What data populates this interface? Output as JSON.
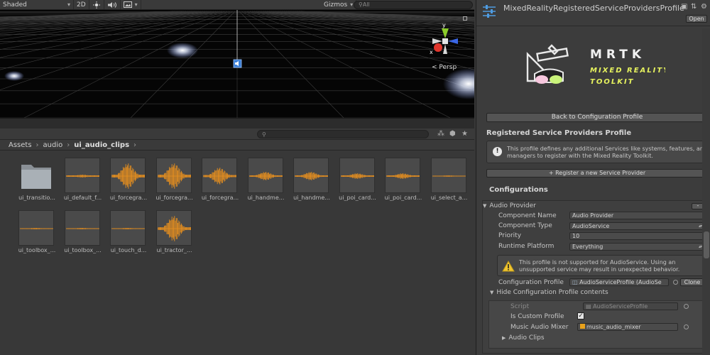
{
  "scene": {
    "shading_mode": "Shaded",
    "mode_2d": "2D",
    "gizmos_label": "Gizmos",
    "search_placeholder": "All",
    "projection_label": "Persp",
    "axis_labels": {
      "y": "y",
      "x": "x"
    }
  },
  "project": {
    "breadcrumb": [
      "Assets",
      "audio",
      "ui_audio_clips"
    ],
    "assets": [
      {
        "label": "ui_transitio...",
        "kind": "folder"
      },
      {
        "label": "ui_default_f...",
        "kind": "clip",
        "wave": "flat"
      },
      {
        "label": "ui_forcegra...",
        "kind": "clip",
        "wave": "loud"
      },
      {
        "label": "ui_forcegra...",
        "kind": "clip",
        "wave": "loud"
      },
      {
        "label": "ui_forcegra...",
        "kind": "clip",
        "wave": "medium"
      },
      {
        "label": "ui_handme...",
        "kind": "clip",
        "wave": "small"
      },
      {
        "label": "ui_handme...",
        "kind": "clip",
        "wave": "small"
      },
      {
        "label": "ui_poi_card...",
        "kind": "clip",
        "wave": "tiny"
      },
      {
        "label": "ui_poi_card...",
        "kind": "clip",
        "wave": "tiny"
      },
      {
        "label": "ui_select_a...",
        "kind": "clip",
        "wave": "line"
      },
      {
        "label": "ui_toolbox_...",
        "kind": "clip",
        "wave": "line"
      },
      {
        "label": "ui_toolbox_...",
        "kind": "clip",
        "wave": "line"
      },
      {
        "label": "ui_touch_d...",
        "kind": "clip",
        "wave": "line"
      },
      {
        "label": "ui_tractor_...",
        "kind": "clip",
        "wave": "loud"
      }
    ]
  },
  "inspector": {
    "title": "MixedRealityRegisteredServiceProvidersProfile",
    "open_label": "Open",
    "logo": {
      "word": "MRTK",
      "line1": "MIXED REALITY",
      "line2": "TOOLKIT"
    },
    "back_label": "Back to Configuration Profile",
    "section_title": "Registered Service Providers Profile",
    "info_text": "This profile defines any additional Services like systems, features, and managers to register with the Mixed Reality Toolkit.",
    "register_label": "+ Register a new Service Provider",
    "configs_label": "Configurations",
    "provider": {
      "name": "Audio Provider",
      "minus_label": "-",
      "component_name_label": "Component Name",
      "component_name_value": "Audio Provider",
      "component_type_label": "Component Type",
      "component_type_value": "AudioService",
      "priority_label": "Priority",
      "priority_value": "10",
      "runtime_platform_label": "Runtime Platform",
      "runtime_platform_value": "Everything",
      "warning_text": "This profile is not supported for AudioService. Using an unsupported service may result in unexpected behavior.",
      "config_profile_label": "Configuration Profile",
      "config_profile_value": "AudioServiceProfile (AudioSe",
      "clone_label": "Clone",
      "hide_contents_label": "Hide Configuration Profile contents",
      "script_label": "Script",
      "script_value": "AudioServiceProfile",
      "is_custom_label": "Is Custom Profile",
      "is_custom_checked": "✓",
      "music_mixer_label": "Music Audio Mixer",
      "music_mixer_value": "music_audio_mixer",
      "audio_clips_label": "Audio Clips"
    }
  },
  "colors": {
    "accent_orange": "#e8901e",
    "axis_green": "#8ccc2a",
    "axis_red": "#e0362c",
    "axis_blue": "#3a66e4"
  }
}
